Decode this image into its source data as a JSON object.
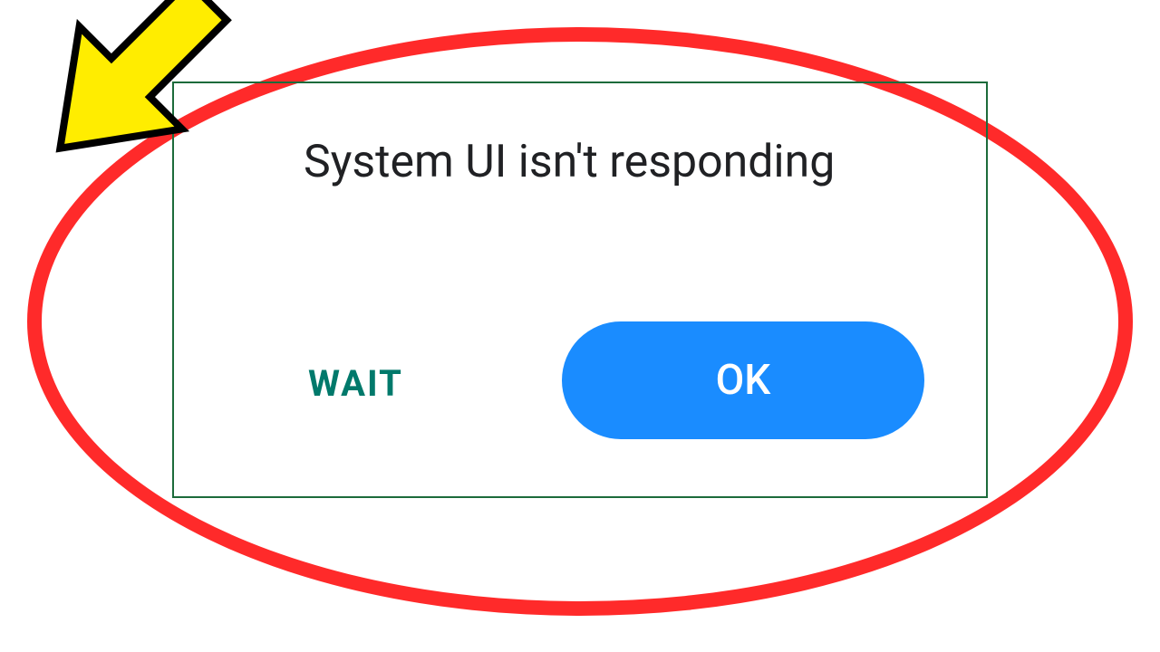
{
  "dialog": {
    "title": "System UI isn't responding",
    "wait_label": "WAIT",
    "ok_label": "OK"
  },
  "annotations": {
    "ellipse_color": "#ff2a2a",
    "arrow_fill": "#ffed00",
    "arrow_stroke": "#000000",
    "green_box_color": "#1c6b3b",
    "ok_button_color": "#1a8cff",
    "wait_text_color": "#00796b"
  }
}
